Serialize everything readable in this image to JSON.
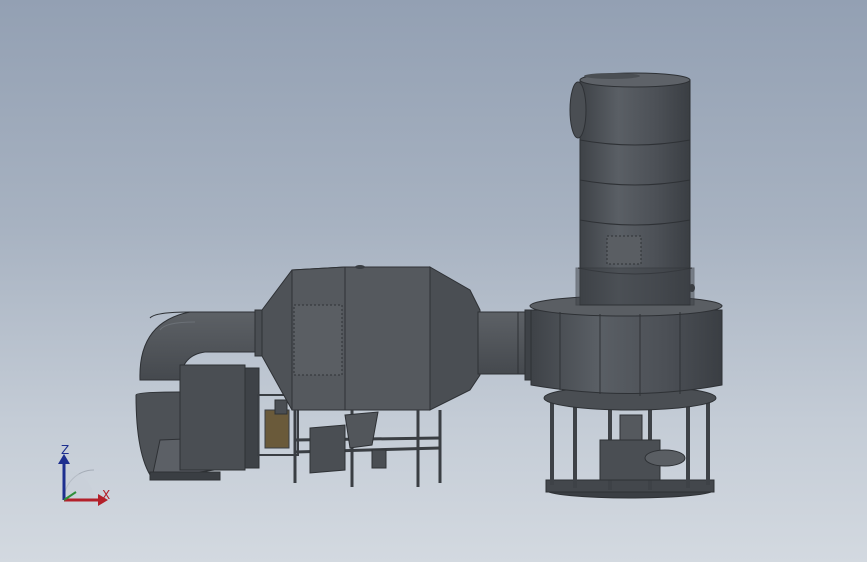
{
  "viewport": {
    "background_top": "#93a0b3",
    "background_bottom": "#d3d9e0",
    "model_color": "#4b4f54"
  },
  "triad": {
    "z_label": "Z",
    "x_label": "X",
    "z_color": "#1d2f8f",
    "x_color": "#b3202a",
    "y_color": "#2f8f3a"
  }
}
